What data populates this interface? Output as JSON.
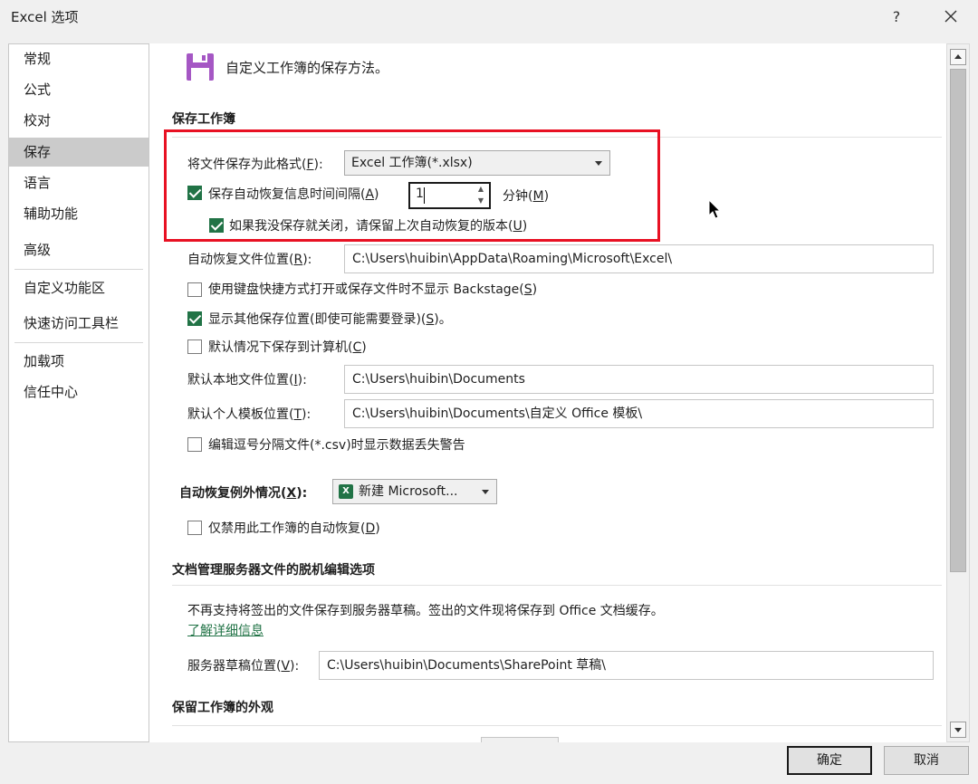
{
  "window": {
    "title": "Excel 选项",
    "help": "?"
  },
  "nav": {
    "items": [
      {
        "label": "常规"
      },
      {
        "label": "公式"
      },
      {
        "label": "校对"
      },
      {
        "label": "保存",
        "active": true
      },
      {
        "label": "语言"
      },
      {
        "label": "辅助功能"
      },
      {
        "label": "高级"
      },
      {
        "label": "自定义功能区"
      },
      {
        "label": "快速访问工具栏"
      },
      {
        "label": "加载项"
      },
      {
        "label": "信任中心"
      }
    ]
  },
  "content": {
    "description": "自定义工作簿的保存方法。",
    "save_section": {
      "heading": "保存工作簿",
      "format_label": "将文件保存为此格式(",
      "format_key": "F",
      "format_label_end": "):",
      "format_value": "Excel 工作簿(*.xlsx)",
      "autorecover_label": "保存自动恢复信息时间间隔(",
      "autorecover_key": "A",
      "autorecover_end": ")",
      "autorecover_checked": true,
      "autorecover_minutes": "1",
      "minutes_label": "分钟(",
      "minutes_key": "M",
      "minutes_end": ")",
      "keep_last_label": "如果我没保存就关闭，请保留上次自动恢复的版本(",
      "keep_last_key": "U",
      "keep_last_end": ")",
      "keep_last_checked": true,
      "ar_location_label": "自动恢复文件位置(",
      "ar_location_key": "R",
      "ar_location_end": "):",
      "ar_location_value": "C:\\Users\\huibin\\AppData\\Roaming\\Microsoft\\Excel\\",
      "no_backstage_label": "使用键盘快捷方式打开或保存文件时不显示 Backstage(",
      "no_backstage_key": "S",
      "no_backstage_end": ")",
      "no_backstage_checked": false,
      "show_other_label": "显示其他保存位置(即使可能需要登录)(",
      "show_other_key": "S",
      "show_other_end": ")。",
      "show_other_checked": true,
      "default_local_label": "默认情况下保存到计算机(",
      "default_local_key": "C",
      "default_local_end": ")",
      "default_local_checked": false,
      "local_location_label": "默认本地文件位置(",
      "local_location_key": "I",
      "local_location_end": "):",
      "local_location_value": "C:\\Users\\huibin\\Documents",
      "template_location_label": "默认个人模板位置(",
      "template_location_key": "T",
      "template_location_end": "):",
      "template_location_value": "C:\\Users\\huibin\\Documents\\自定义 Office 模板\\",
      "csv_warning_label": "编辑逗号分隔文件(*.csv)时显示数据丢失警告",
      "csv_warning_checked": false
    },
    "exceptions": {
      "label": "自动恢复例外情况(",
      "key": "X",
      "end": "):",
      "workbook_value": "新建 Microsoft...",
      "disable_label": "仅禁用此工作簿的自动恢复(",
      "disable_key": "D",
      "disable_end": ")",
      "disable_checked": false
    },
    "offline": {
      "heading": "文档管理服务器文件的脱机编辑选项",
      "notice": "不再支持将签出的文件保存到服务器草稿。签出的文件现将保存到 Office 文档缓存。",
      "learn_more": "了解详细信息",
      "drafts_label": "服务器草稿位置(",
      "drafts_key": "V",
      "drafts_end": "):",
      "drafts_value": "C:\\Users\\huibin\\Documents\\SharePoint 草稿\\"
    },
    "appearance": {
      "heading": "保留工作簿的外观"
    }
  },
  "buttons": {
    "ok": "确定",
    "cancel": "取消"
  },
  "colors": {
    "accent": "#217346",
    "highlight_box": "#e81123",
    "save_icon": "#a557c4"
  }
}
